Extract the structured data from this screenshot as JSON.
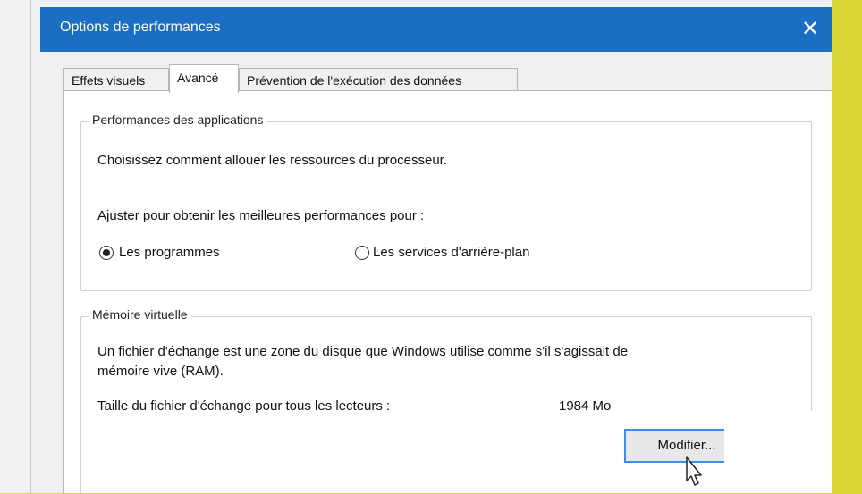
{
  "window": {
    "title": "Options de performances",
    "close_symbol": "✕"
  },
  "tabs": [
    {
      "label": "Effets visuels",
      "active": false
    },
    {
      "label": "Avancé",
      "active": true
    },
    {
      "label": "Prévention de l'exécution des données",
      "active": false
    }
  ],
  "app_performance": {
    "legend": "Performances des applications",
    "description": "Choisissez comment allouer les ressources du processeur.",
    "adjust_label": "Ajuster pour obtenir les meilleures performances pour :",
    "option_programs": "Les programmes",
    "option_background": "Les services d'arrière-plan",
    "selected": "programs"
  },
  "virtual_memory": {
    "legend": "Mémoire virtuelle",
    "description_line1": "Un fichier d'échange est une zone du disque que Windows utilise comme s'il s'agissait de",
    "description_line2": "mémoire vive (RAM).",
    "size_label": "Taille du fichier d'échange pour tous les lecteurs :",
    "size_value": "1984 Mo",
    "modify_button": "Modifier..."
  },
  "colors": {
    "titlebar": "#1a6fc4",
    "background_frame": "#dcd83a",
    "button_border": "#3d8ee6"
  }
}
